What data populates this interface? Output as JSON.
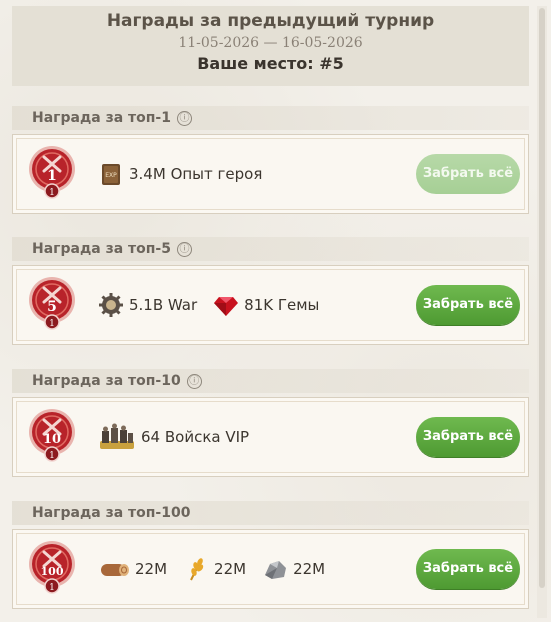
{
  "header": {
    "title": "Награды за предыдущий турнир",
    "dates": "11-05-2026 — 16-05-2026",
    "place": "Ваше место: #5"
  },
  "sections": [
    {
      "label": "Награда за топ-1",
      "info_icon": "ⓘ",
      "rank": "1",
      "medal_level": "1",
      "rewards": [
        {
          "icon": "exp-book-icon",
          "text": "3.4M Опыт героя"
        }
      ],
      "claim_label": "Забрать всё",
      "claim_enabled": false
    },
    {
      "label": "Награда за топ-5",
      "info_icon": "ⓘ",
      "rank": "5",
      "medal_level": "1",
      "rewards": [
        {
          "icon": "war-gear-icon",
          "text": "5.1B War"
        },
        {
          "icon": "gem-icon",
          "text": "81K Гемы"
        }
      ],
      "claim_label": "Забрать всё",
      "claim_enabled": true
    },
    {
      "label": "Награда за топ-10",
      "info_icon": "ⓘ",
      "rank": "10",
      "medal_level": "1",
      "rewards": [
        {
          "icon": "troops-icon",
          "text": "64 Войска VIP"
        }
      ],
      "claim_label": "Забрать всё",
      "claim_enabled": true
    },
    {
      "label": "Награда за топ-100",
      "rank": "100",
      "medal_level": "1",
      "rewards": [
        {
          "icon": "wood-log-icon",
          "text": "22M"
        },
        {
          "icon": "wheat-icon",
          "text": "22M"
        },
        {
          "icon": "stone-icon",
          "text": "22M"
        }
      ],
      "claim_label": "Забрать всё",
      "claim_enabled": true
    }
  ],
  "colors": {
    "claim_button": "#5aa83c",
    "claim_button_disabled": "#aed39c",
    "medal_red": "#b8232a"
  }
}
